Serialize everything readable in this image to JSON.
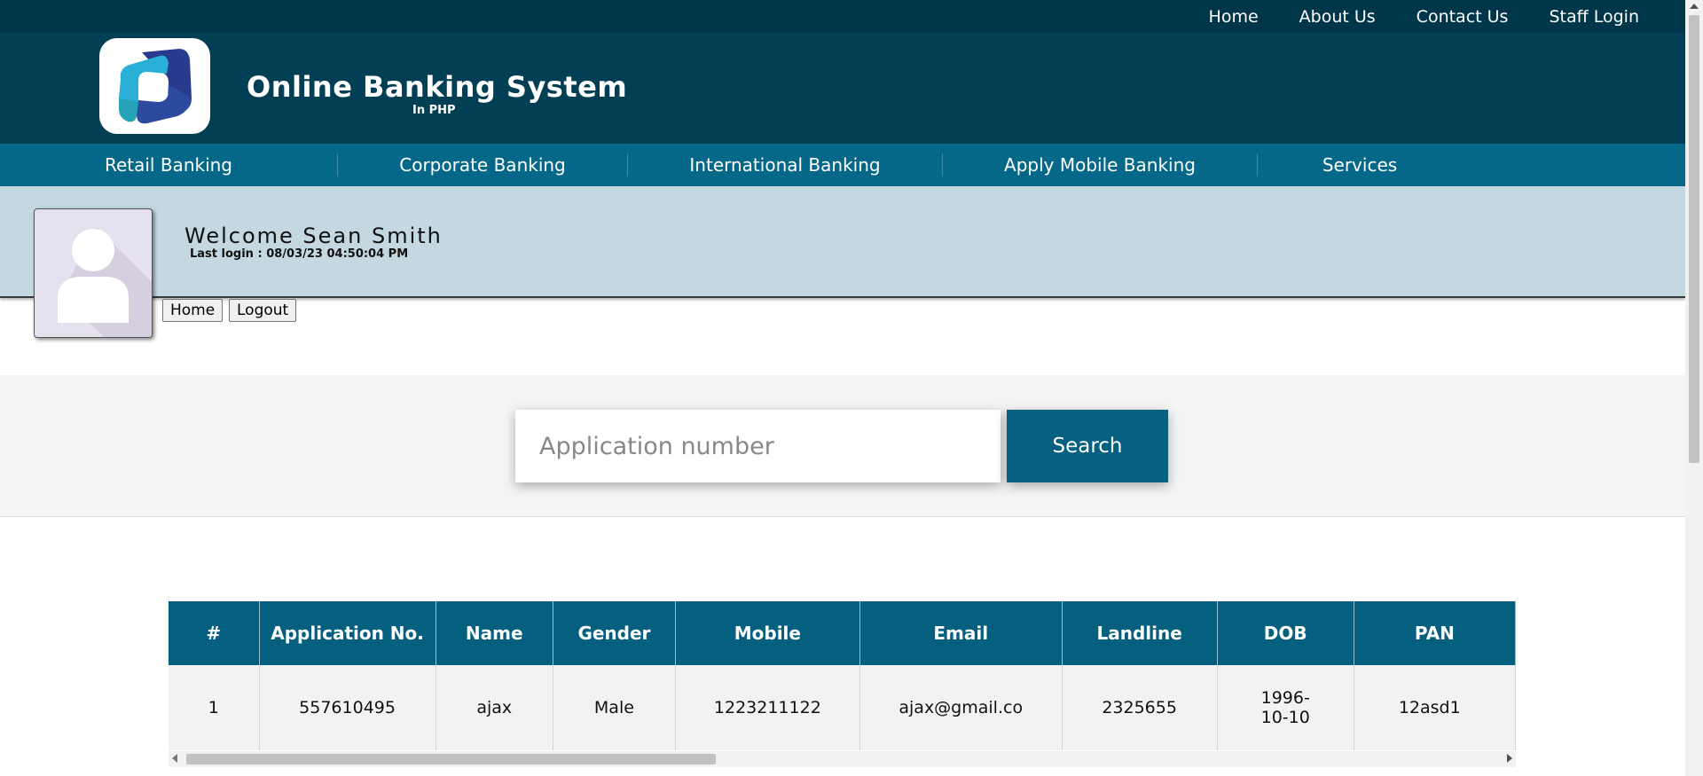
{
  "top_nav": [
    "Home",
    "About Us",
    "Contact Us",
    "Staff Login"
  ],
  "brand": {
    "title": "Online Banking System",
    "subtitle": "In PHP"
  },
  "main_nav": [
    "Retail Banking",
    "Corporate Banking",
    "International Banking",
    "Apply Mobile Banking",
    "Services"
  ],
  "user": {
    "welcome": "Welcome  Sean  Smith",
    "last_login": "Last login : 08/03/23 04:50:04 PM"
  },
  "buttons": {
    "home": "Home",
    "logout": "Logout"
  },
  "search": {
    "placeholder": "Application number",
    "value": "",
    "button": "Search"
  },
  "table": {
    "columns": [
      "#",
      "Application No.",
      "Name",
      "Gender",
      "Mobile",
      "Email",
      "Landline",
      "DOB",
      "PAN"
    ],
    "rows": [
      [
        "1",
        "557610495",
        "ajax",
        "Male",
        "1223211122",
        "ajax@gmail.co",
        "2325655",
        "1996-10-10",
        "12asd1"
      ]
    ]
  },
  "colors": {
    "topbar": "#00364a",
    "header": "#023f54",
    "nav": "#066888",
    "welcome_band": "#c3d8e1",
    "accent": "#05607f"
  }
}
